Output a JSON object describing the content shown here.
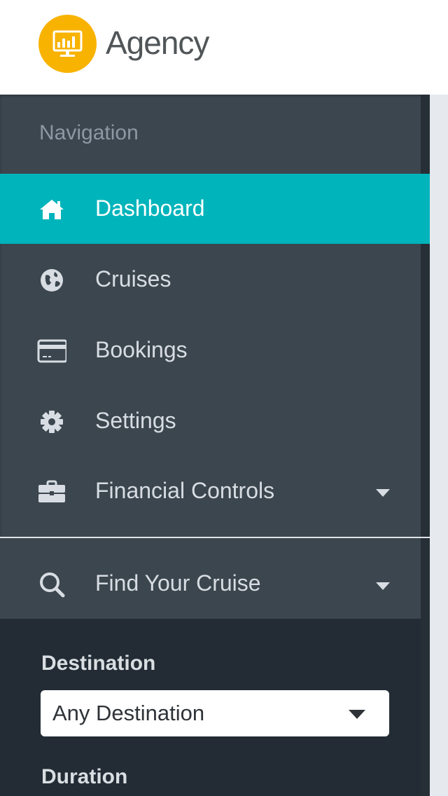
{
  "app": {
    "brand_name": "Agency",
    "brand_color": "#f8b300",
    "logo_icon": "presentation-chart-icon"
  },
  "sidebar": {
    "heading": "Navigation",
    "items": [
      {
        "label": "Dashboard",
        "icon": "home-icon",
        "active": true
      },
      {
        "label": "Cruises",
        "icon": "globe-icon",
        "active": false
      },
      {
        "label": "Bookings",
        "icon": "credit-card-icon",
        "active": false
      },
      {
        "label": "Settings",
        "icon": "gear-icon",
        "active": false
      },
      {
        "label": "Financial Controls",
        "icon": "briefcase-icon",
        "active": false,
        "has_dropdown": true
      }
    ],
    "active_color": "#00b4bb",
    "background_color": "#3c464f"
  },
  "find_cruise": {
    "label": "Find Your Cruise",
    "icon": "search-icon",
    "expanded": true,
    "fields": [
      {
        "label": "Destination",
        "value": "Any Destination"
      },
      {
        "label": "Duration"
      }
    ]
  }
}
